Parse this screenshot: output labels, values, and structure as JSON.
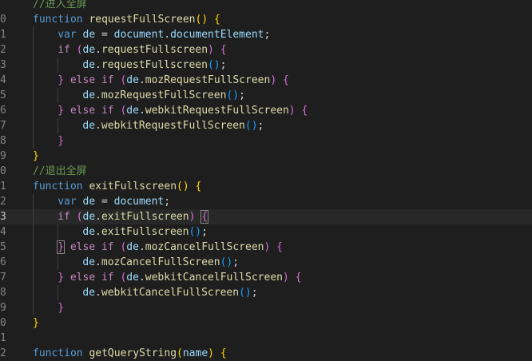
{
  "editor": {
    "language": "javascript",
    "lines": [
      {
        "n": "",
        "indent": 0,
        "t": [
          [
            "com",
            "//进入全屏"
          ]
        ]
      },
      {
        "n": "0",
        "indent": 0,
        "t": [
          [
            "kw",
            "function"
          ],
          [
            "pl",
            " "
          ],
          [
            "fn",
            "requestFullScreen"
          ],
          [
            "br1",
            "()"
          ],
          [
            "pl",
            " "
          ],
          [
            "br1",
            "{"
          ]
        ]
      },
      {
        "n": "1",
        "indent": 1,
        "t": [
          [
            "kw",
            "var"
          ],
          [
            "pl",
            " "
          ],
          [
            "var",
            "de"
          ],
          [
            "pl",
            " = "
          ],
          [
            "var",
            "document"
          ],
          [
            "pl",
            "."
          ],
          [
            "var",
            "documentElement"
          ],
          [
            "pl",
            ";"
          ]
        ]
      },
      {
        "n": "2",
        "indent": 1,
        "t": [
          [
            "ctl",
            "if"
          ],
          [
            "pl",
            " "
          ],
          [
            "br2",
            "("
          ],
          [
            "var",
            "de"
          ],
          [
            "pl",
            "."
          ],
          [
            "fn",
            "requestFullscreen"
          ],
          [
            "br2",
            ")"
          ],
          [
            "pl",
            " "
          ],
          [
            "br2",
            "{"
          ]
        ]
      },
      {
        "n": "3",
        "indent": 2,
        "t": [
          [
            "var",
            "de"
          ],
          [
            "pl",
            "."
          ],
          [
            "fn",
            "requestFullscreen"
          ],
          [
            "br3",
            "()"
          ],
          [
            "pl",
            ";"
          ]
        ]
      },
      {
        "n": "4",
        "indent": 1,
        "t": [
          [
            "br2",
            "}"
          ],
          [
            "pl",
            " "
          ],
          [
            "ctl",
            "else if"
          ],
          [
            "pl",
            " "
          ],
          [
            "br2",
            "("
          ],
          [
            "var",
            "de"
          ],
          [
            "pl",
            "."
          ],
          [
            "fn",
            "mozRequestFullScreen"
          ],
          [
            "br2",
            ")"
          ],
          [
            "pl",
            " "
          ],
          [
            "br2",
            "{"
          ]
        ]
      },
      {
        "n": "5",
        "indent": 2,
        "t": [
          [
            "var",
            "de"
          ],
          [
            "pl",
            "."
          ],
          [
            "fn",
            "mozRequestFullScreen"
          ],
          [
            "br3",
            "()"
          ],
          [
            "pl",
            ";"
          ]
        ]
      },
      {
        "n": "6",
        "indent": 1,
        "t": [
          [
            "br2",
            "}"
          ],
          [
            "pl",
            " "
          ],
          [
            "ctl",
            "else if"
          ],
          [
            "pl",
            " "
          ],
          [
            "br2",
            "("
          ],
          [
            "var",
            "de"
          ],
          [
            "pl",
            "."
          ],
          [
            "fn",
            "webkitRequestFullScreen"
          ],
          [
            "br2",
            ")"
          ],
          [
            "pl",
            " "
          ],
          [
            "br2",
            "{"
          ]
        ]
      },
      {
        "n": "7",
        "indent": 2,
        "t": [
          [
            "var",
            "de"
          ],
          [
            "pl",
            "."
          ],
          [
            "fn",
            "webkitRequestFullScreen"
          ],
          [
            "br3",
            "()"
          ],
          [
            "pl",
            ";"
          ]
        ]
      },
      {
        "n": "8",
        "indent": 1,
        "t": [
          [
            "br2",
            "}"
          ]
        ]
      },
      {
        "n": "9",
        "indent": 0,
        "t": [
          [
            "br1",
            "}"
          ]
        ]
      },
      {
        "n": "0",
        "indent": 0,
        "t": [
          [
            "com",
            "//退出全屏"
          ]
        ]
      },
      {
        "n": "1",
        "indent": 0,
        "t": [
          [
            "kw",
            "function"
          ],
          [
            "pl",
            " "
          ],
          [
            "fn",
            "exitFullscreen"
          ],
          [
            "br1",
            "()"
          ],
          [
            "pl",
            " "
          ],
          [
            "br1",
            "{"
          ]
        ]
      },
      {
        "n": "2",
        "indent": 1,
        "t": [
          [
            "kw",
            "var"
          ],
          [
            "pl",
            " "
          ],
          [
            "var",
            "de"
          ],
          [
            "pl",
            " = "
          ],
          [
            "var",
            "document"
          ],
          [
            "pl",
            ";"
          ]
        ]
      },
      {
        "n": "3",
        "indent": 1,
        "active": true,
        "t": [
          [
            "ctl",
            "if"
          ],
          [
            "pl",
            " "
          ],
          [
            "br2",
            "("
          ],
          [
            "var",
            "de"
          ],
          [
            "pl",
            "."
          ],
          [
            "fn",
            "exitFullscreen"
          ],
          [
            "br2",
            ")"
          ],
          [
            "pl",
            " "
          ],
          [
            "br2m",
            "{"
          ]
        ]
      },
      {
        "n": "4",
        "indent": 2,
        "t": [
          [
            "var",
            "de"
          ],
          [
            "pl",
            "."
          ],
          [
            "fn",
            "exitFullscreen"
          ],
          [
            "br3",
            "()"
          ],
          [
            "pl",
            ";"
          ]
        ]
      },
      {
        "n": "5",
        "indent": 1,
        "t": [
          [
            "br2m",
            "}"
          ],
          [
            "pl",
            " "
          ],
          [
            "ctl",
            "else if"
          ],
          [
            "pl",
            " "
          ],
          [
            "br2",
            "("
          ],
          [
            "var",
            "de"
          ],
          [
            "pl",
            "."
          ],
          [
            "fn",
            "mozCancelFullScreen"
          ],
          [
            "br2",
            ")"
          ],
          [
            "pl",
            " "
          ],
          [
            "br2",
            "{"
          ]
        ]
      },
      {
        "n": "6",
        "indent": 2,
        "t": [
          [
            "var",
            "de"
          ],
          [
            "pl",
            "."
          ],
          [
            "fn",
            "mozCancelFullScreen"
          ],
          [
            "br3",
            "()"
          ],
          [
            "pl",
            ";"
          ]
        ]
      },
      {
        "n": "7",
        "indent": 1,
        "t": [
          [
            "br2",
            "}"
          ],
          [
            "pl",
            " "
          ],
          [
            "ctl",
            "else if"
          ],
          [
            "pl",
            " "
          ],
          [
            "br2",
            "("
          ],
          [
            "var",
            "de"
          ],
          [
            "pl",
            "."
          ],
          [
            "fn",
            "webkitCancelFullScreen"
          ],
          [
            "br2",
            ")"
          ],
          [
            "pl",
            " "
          ],
          [
            "br2",
            "{"
          ]
        ]
      },
      {
        "n": "8",
        "indent": 2,
        "t": [
          [
            "var",
            "de"
          ],
          [
            "pl",
            "."
          ],
          [
            "fn",
            "webkitCancelFullScreen"
          ],
          [
            "br3",
            "()"
          ],
          [
            "pl",
            ";"
          ]
        ]
      },
      {
        "n": "9",
        "indent": 1,
        "t": [
          [
            "br2",
            "}"
          ]
        ]
      },
      {
        "n": "0",
        "indent": 0,
        "t": [
          [
            "br1",
            "}"
          ]
        ]
      },
      {
        "n": "1",
        "indent": 0,
        "t": []
      },
      {
        "n": "2",
        "indent": 0,
        "t": [
          [
            "kw",
            "function"
          ],
          [
            "pl",
            " "
          ],
          [
            "fn",
            "getQueryString"
          ],
          [
            "br1",
            "("
          ],
          [
            "var",
            "name"
          ],
          [
            "br1",
            ")"
          ],
          [
            "pl",
            " "
          ],
          [
            "br1",
            "{"
          ]
        ]
      }
    ]
  }
}
